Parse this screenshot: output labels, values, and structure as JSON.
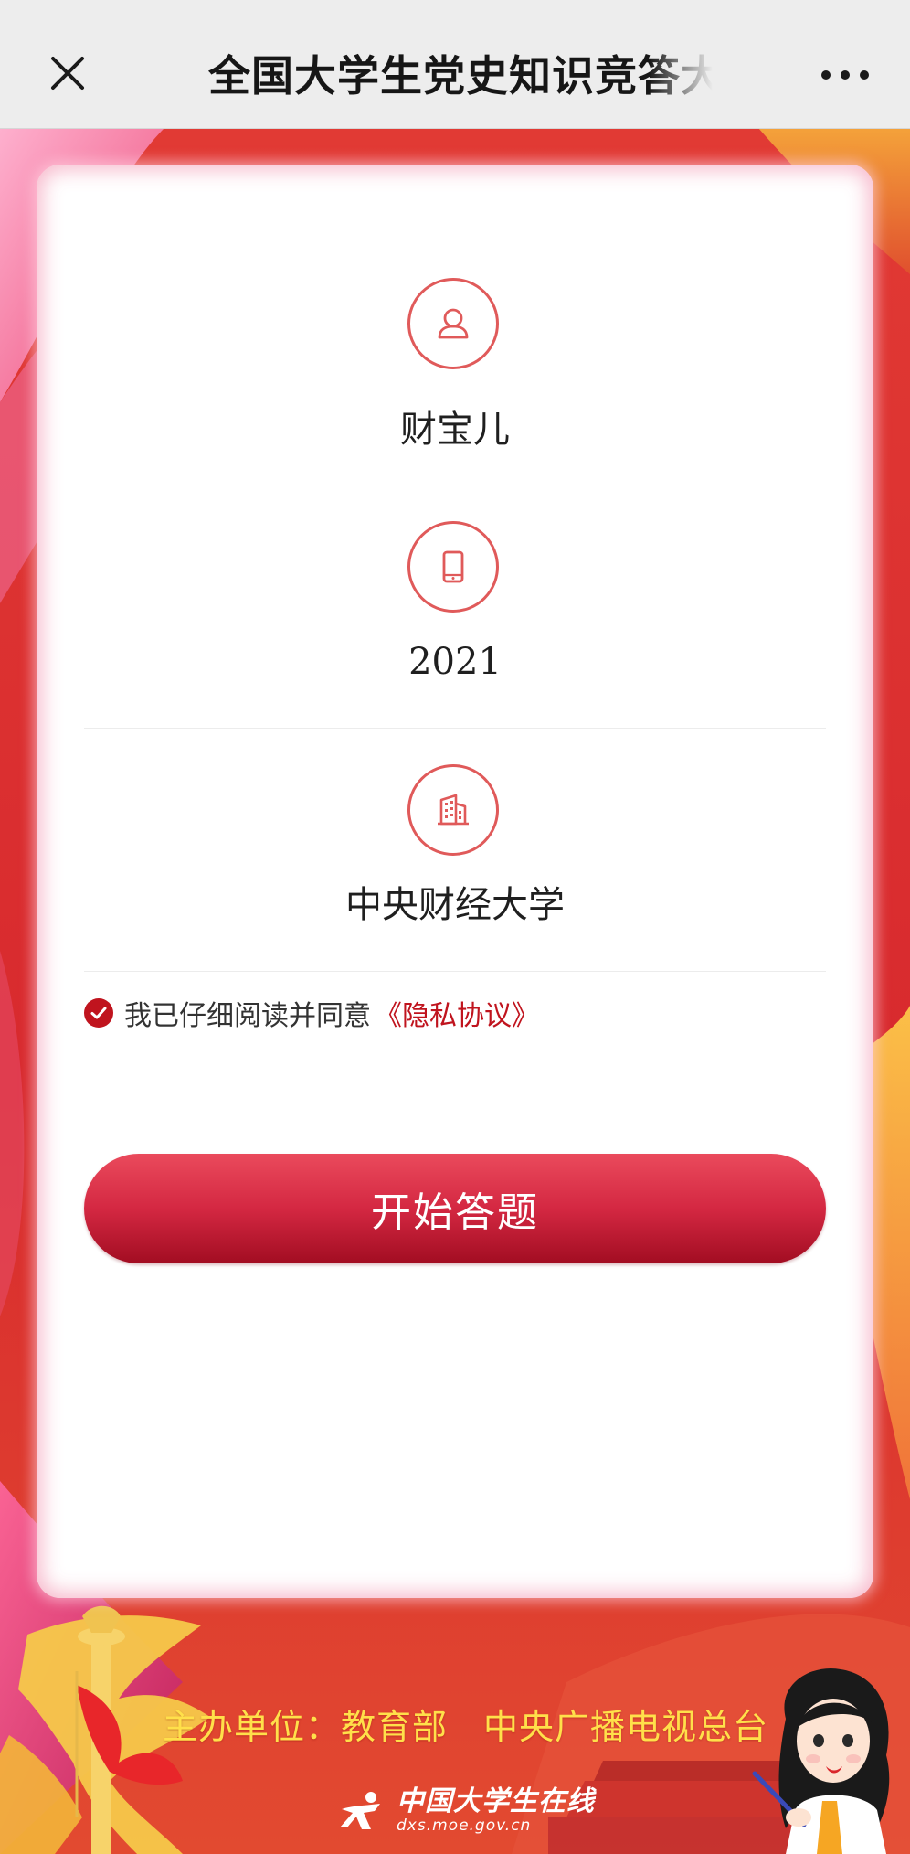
{
  "nav": {
    "title": "全国大学生党史知识竞答大",
    "close_icon": "close-icon",
    "more_icon": "more-dots-icon"
  },
  "form": {
    "name_icon": "user-icon",
    "name_value": "财宝儿",
    "phone_icon": "phone-icon",
    "phone_value": "2021",
    "school_icon": "building-icon",
    "school_value": "中央财经大学",
    "agree_text": "我已仔细阅读并同意",
    "privacy_link": "《隐私协议》",
    "agree_checked": true,
    "start_button": "开始答题"
  },
  "footer": {
    "sponsor": "主办单位：教育部　中央广播电视总台",
    "site_name": "中国大学生在线",
    "site_url": "dxs.moe.gov.cn"
  },
  "colors": {
    "accent_red": "#c0141e",
    "background_red": "#d9262c",
    "sponsor_yellow": "#ffe04a",
    "topbar_gray": "#ededed"
  }
}
